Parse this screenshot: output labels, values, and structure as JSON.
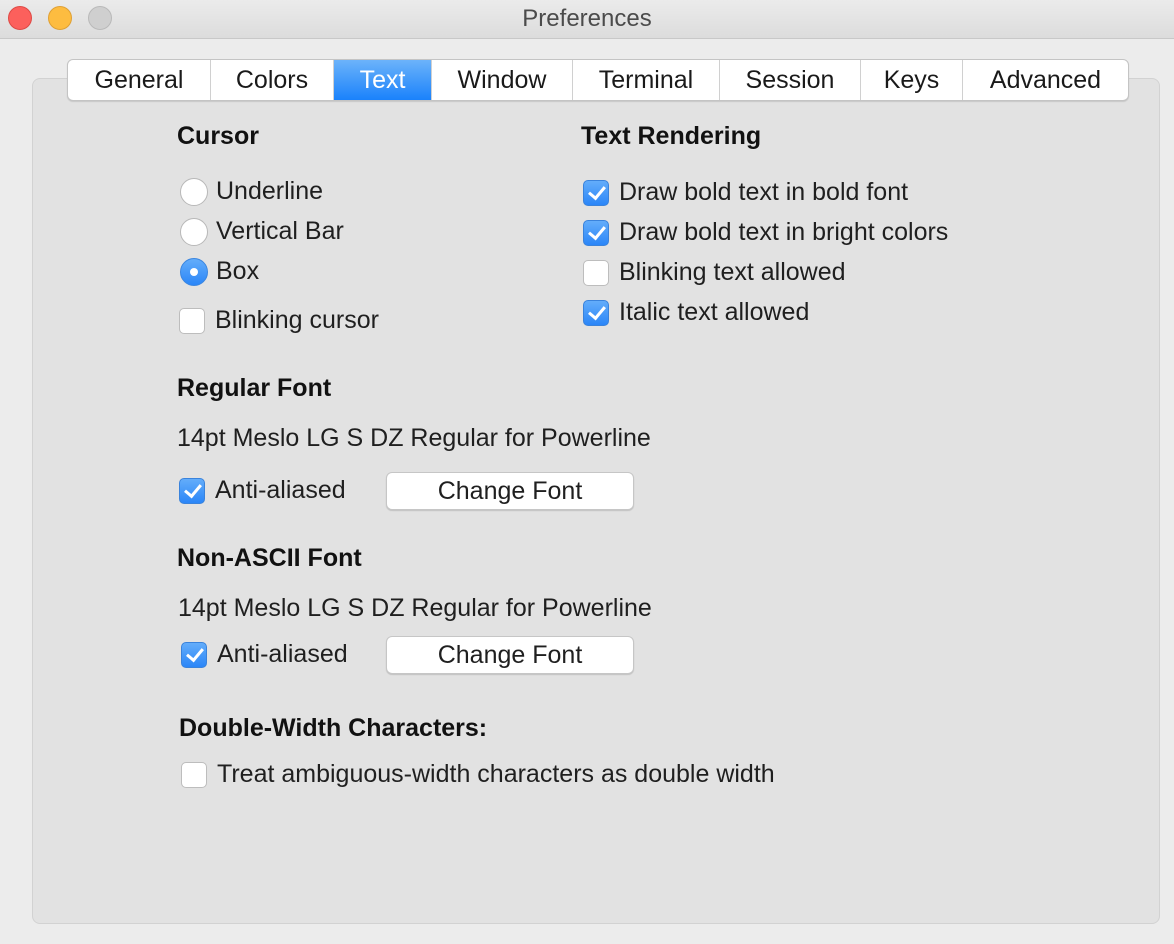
{
  "window": {
    "title": "Preferences"
  },
  "tabs": [
    {
      "label": "General",
      "active": false
    },
    {
      "label": "Colors",
      "active": false
    },
    {
      "label": "Text",
      "active": true
    },
    {
      "label": "Window",
      "active": false
    },
    {
      "label": "Terminal",
      "active": false
    },
    {
      "label": "Session",
      "active": false
    },
    {
      "label": "Keys",
      "active": false
    },
    {
      "label": "Advanced",
      "active": false
    }
  ],
  "cursor": {
    "heading": "Cursor",
    "options": [
      {
        "label": "Underline",
        "selected": false
      },
      {
        "label": "Vertical Bar",
        "selected": false
      },
      {
        "label": "Box",
        "selected": true
      }
    ],
    "blinking": {
      "label": "Blinking cursor",
      "checked": false
    }
  },
  "text_rendering": {
    "heading": "Text Rendering",
    "options": [
      {
        "label": "Draw bold text in bold font",
        "checked": true
      },
      {
        "label": "Draw bold text in bright colors",
        "checked": true
      },
      {
        "label": "Blinking text allowed",
        "checked": false
      },
      {
        "label": "Italic text allowed",
        "checked": true
      }
    ]
  },
  "regular_font": {
    "heading": "Regular Font",
    "description": "14pt Meslo LG S DZ Regular for Powerline",
    "antialias": {
      "label": "Anti-aliased",
      "checked": true
    },
    "button": "Change Font"
  },
  "non_ascii_font": {
    "heading": "Non-ASCII Font",
    "description": "14pt Meslo LG S DZ Regular for Powerline",
    "antialias": {
      "label": "Anti-aliased",
      "checked": true
    },
    "button": "Change Font"
  },
  "double_width": {
    "heading": "Double-Width Characters:",
    "option": {
      "label": "Treat ambiguous-width characters as double width",
      "checked": false
    }
  },
  "colors": {
    "accent": "#2b86f8",
    "close": "#fc605c",
    "minimize": "#fdbc40",
    "zoom_disabled": "#cfcfcf"
  }
}
